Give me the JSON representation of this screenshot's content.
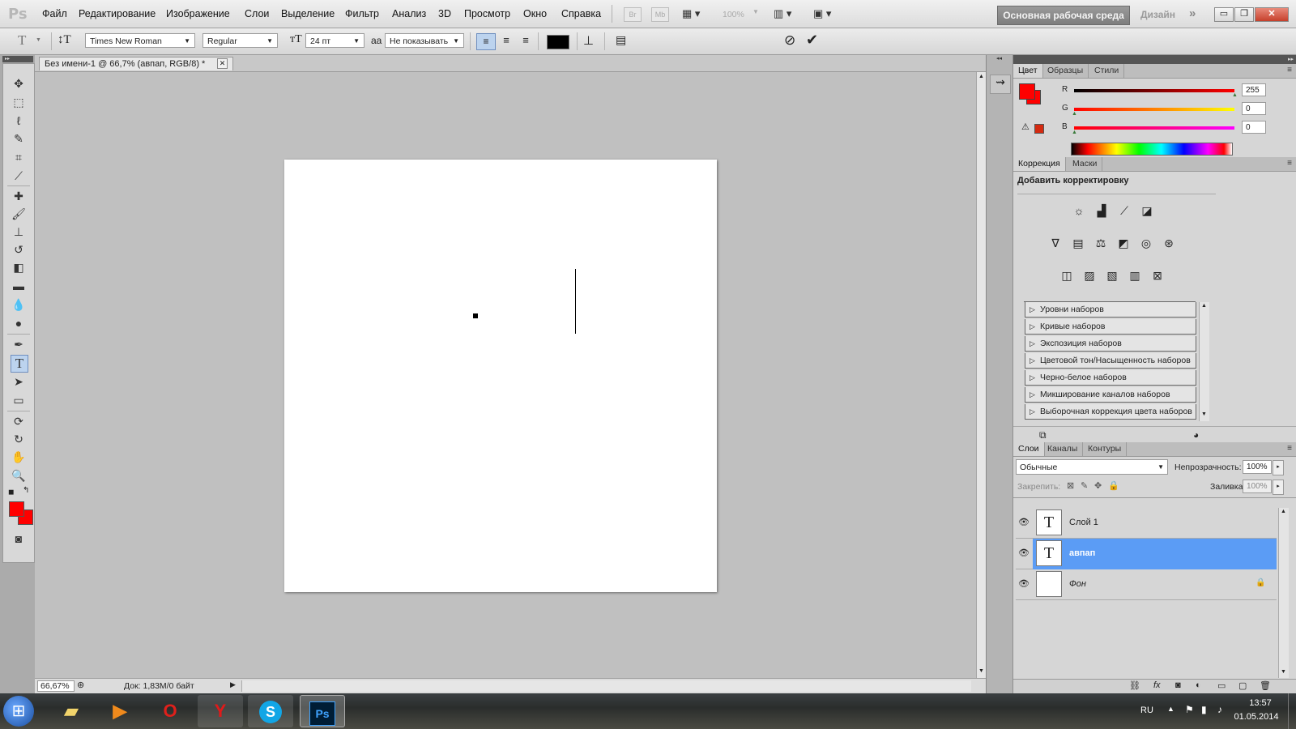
{
  "app": {
    "logo": "Ps"
  },
  "menu": {
    "items": [
      "Файл",
      "Редактирование",
      "Изображение",
      "Слои",
      "Выделение",
      "Фильтр",
      "Анализ",
      "3D",
      "Просмотр",
      "Окно",
      "Справка"
    ],
    "br_label": "Br",
    "mb_label": "Mb",
    "zoom_label": "100%",
    "workspace_button": "Основная рабочая среда",
    "design_label": "Дизайн"
  },
  "options": {
    "font_family": "Times New Roman",
    "font_style": "Regular",
    "font_size": "24 пт",
    "antialias_icon": "aa",
    "antialias": "Не показывать",
    "text_color": "#000000"
  },
  "document": {
    "tab_title": "Без имени-1 @ 66,7% (авпап, RGB/8) *",
    "zoom": "66,67%",
    "doc_info": "Док: 1,83M/0 байт"
  },
  "tools": {
    "foreground_color": "#ff0000",
    "background_color": "#ff0000"
  },
  "color_panel": {
    "tabs": [
      "Цвет",
      "Образцы",
      "Стили"
    ],
    "r_label": "R",
    "g_label": "G",
    "b_label": "B",
    "r": "255",
    "g": "0",
    "b": "0",
    "foreground": "#ff0000",
    "background": "#ff0000"
  },
  "adjustments_panel": {
    "tabs": [
      "Коррекция",
      "Маски"
    ],
    "heading": "Добавить корректировку",
    "presets": [
      "Уровни наборов",
      "Кривые наборов",
      "Экспозиция наборов",
      "Цветовой тон/Насыщенность наборов",
      "Черно-белое наборов",
      "Микширование каналов наборов",
      "Выборочная коррекция цвета наборов"
    ]
  },
  "layers_panel": {
    "tabs": [
      "Слои",
      "Каналы",
      "Контуры"
    ],
    "blend_mode": "Обычные",
    "opacity_label": "Непрозрачность:",
    "opacity": "100%",
    "lock_label": "Закрепить:",
    "fill_label": "Заливка:",
    "fill": "100%",
    "layers": [
      {
        "name": "Слой 1",
        "type": "text",
        "thumb": "T",
        "selected": false
      },
      {
        "name": "авпап",
        "type": "text",
        "thumb": "T",
        "selected": true
      },
      {
        "name": "Фон",
        "type": "background",
        "thumb": "",
        "selected": false
      }
    ],
    "selected_color": "#5b9cf5"
  },
  "taskbar": {
    "language": "RU",
    "time": "13:57",
    "date": "01.05.2014",
    "apps": [
      "windows-explorer",
      "media-player",
      "opera",
      "yandex-browser",
      "skype",
      "photoshop"
    ],
    "photoshop_label": "Ps",
    "skype_label": "S"
  }
}
